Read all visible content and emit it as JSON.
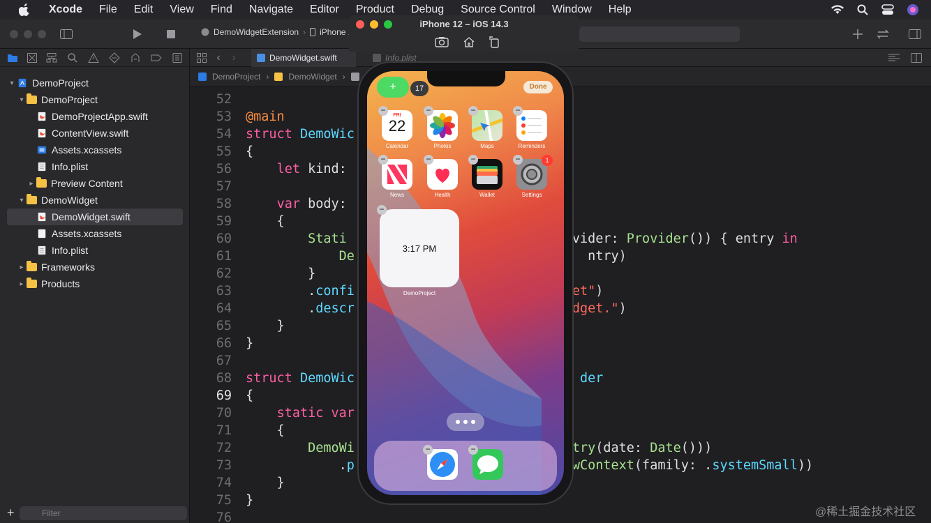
{
  "menubar": {
    "app_name": "Xcode",
    "items": [
      "File",
      "Edit",
      "View",
      "Find",
      "Navigate",
      "Editor",
      "Product",
      "Debug",
      "Source Control",
      "Window",
      "Help"
    ]
  },
  "toolbar": {
    "scheme_target": "DemoWidgetExtension",
    "scheme_device": "iPhone 1"
  },
  "tabs": {
    "active": "DemoWidget.swift",
    "inactive": "Info.plist"
  },
  "jumpbar": {
    "path": [
      "DemoProject",
      "DemoWidget",
      "De"
    ]
  },
  "navigator": {
    "items": [
      {
        "label": "DemoProject",
        "kind": "project"
      },
      {
        "label": "DemoProject",
        "kind": "folder"
      },
      {
        "label": "DemoProjectApp.swift",
        "kind": "swift"
      },
      {
        "label": "ContentView.swift",
        "kind": "swift"
      },
      {
        "label": "Assets.xcassets",
        "kind": "assets"
      },
      {
        "label": "Info.plist",
        "kind": "plist"
      },
      {
        "label": "Preview Content",
        "kind": "folder"
      },
      {
        "label": "DemoWidget",
        "kind": "folder"
      },
      {
        "label": "DemoWidget.swift",
        "kind": "swift"
      },
      {
        "label": "Assets.xcassets",
        "kind": "assets"
      },
      {
        "label": "Info.plist",
        "kind": "plist"
      },
      {
        "label": "Frameworks",
        "kind": "folder"
      },
      {
        "label": "Products",
        "kind": "folder"
      }
    ],
    "filter_placeholder": "Filter"
  },
  "editor": {
    "line_numbers": [
      "52",
      "53",
      "54",
      "55",
      "56",
      "57",
      "58",
      "59",
      "60",
      "61",
      "62",
      "63",
      "64",
      "65",
      "66",
      "67",
      "68",
      "69",
      "70",
      "71",
      "72",
      "73",
      "74",
      "75",
      "76"
    ],
    "current_line": "69"
  },
  "simulator": {
    "title": "iPhone 12 – iOS 14.3",
    "add_label": "+",
    "widget_count": "17",
    "done_label": "Done",
    "apps": [
      {
        "label": "Calendar",
        "day": "FRI",
        "date": "22"
      },
      {
        "label": "Photos"
      },
      {
        "label": "Maps"
      },
      {
        "label": "Reminders"
      },
      {
        "label": "News"
      },
      {
        "label": "Health"
      },
      {
        "label": "Wallet"
      },
      {
        "label": "Settings",
        "badge": "1"
      }
    ],
    "widget_time": "3:17 PM",
    "widget_label": "DemoProject"
  },
  "watermark": "@稀土掘金技术社区",
  "colors": {
    "keyword": "#fc5fa3",
    "type": "#5dd8ff",
    "string": "#fc6a5d",
    "class": "#a8e08f",
    "accent": "#2d7be5"
  }
}
